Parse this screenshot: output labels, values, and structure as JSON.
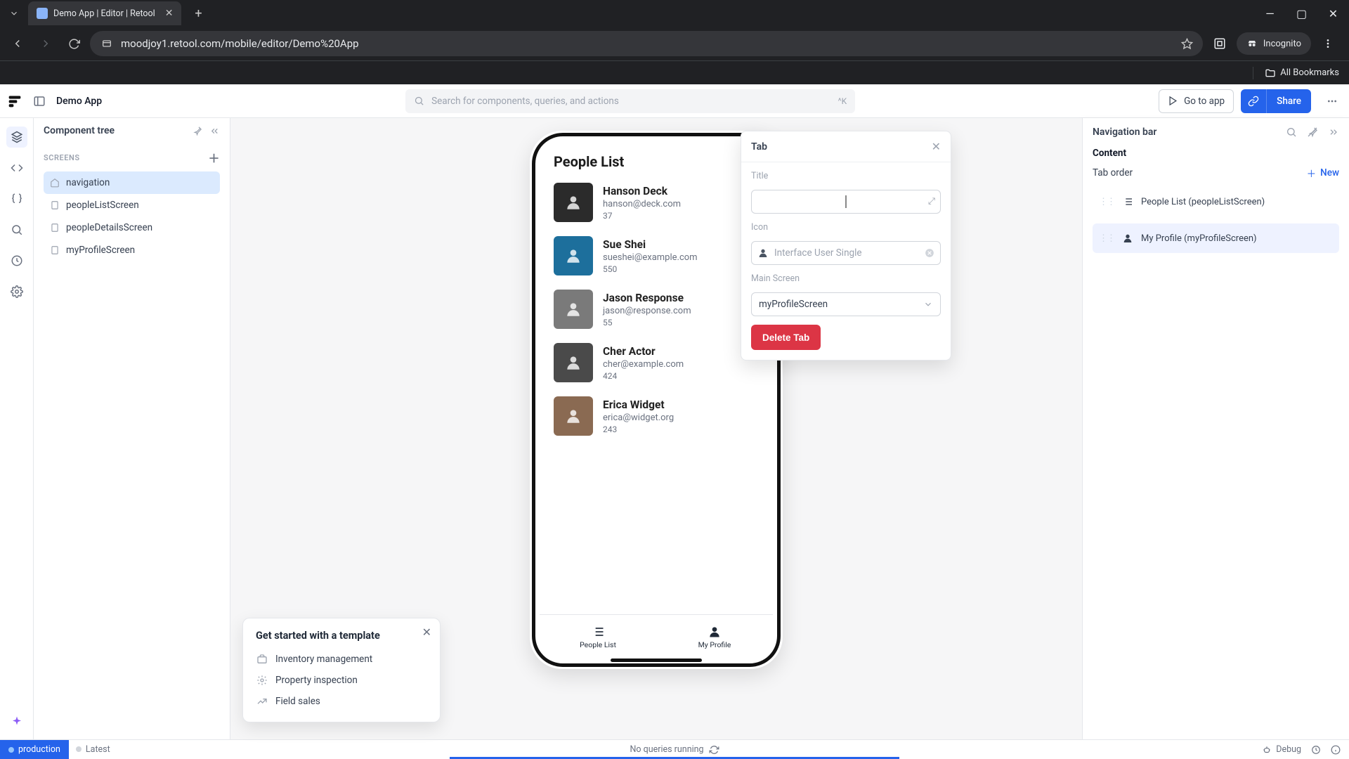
{
  "browser": {
    "tab_title": "Demo App | Editor | Retool",
    "url": "moodjoy1.retool.com/mobile/editor/Demo%20App",
    "incognito_label": "Incognito",
    "all_bookmarks": "All Bookmarks"
  },
  "header": {
    "app_name": "Demo App",
    "search_placeholder": "Search for components, queries, and actions",
    "search_kbd": "^K",
    "go_to_app": "Go to app",
    "share": "Share"
  },
  "tree": {
    "title": "Component tree",
    "section_screens": "SCREENS",
    "nodes": [
      {
        "label": "navigation",
        "selected": true
      },
      {
        "label": "peopleListScreen",
        "selected": false
      },
      {
        "label": "peopleDetailsScreen",
        "selected": false
      },
      {
        "label": "myProfileScreen",
        "selected": false
      }
    ]
  },
  "phone": {
    "title": "People List",
    "tabs": {
      "people": "People List",
      "profile": "My Profile"
    },
    "people": [
      {
        "name": "Hanson Deck",
        "email": "hanson@deck.com",
        "count": "37"
      },
      {
        "name": "Sue Shei",
        "email": "sueshei@example.com",
        "count": "550"
      },
      {
        "name": "Jason Response",
        "email": "jason@response.com",
        "count": "55"
      },
      {
        "name": "Cher Actor",
        "email": "cher@example.com",
        "count": "424"
      },
      {
        "name": "Erica Widget",
        "email": "erica@widget.org",
        "count": "243"
      }
    ]
  },
  "tab_popover": {
    "title": "Tab",
    "title_label": "Title",
    "title_value": "",
    "icon_label": "Icon",
    "icon_value": "Interface User Single",
    "mainscreen_label": "Main Screen",
    "mainscreen_value": "myProfileScreen",
    "delete_label": "Delete Tab"
  },
  "inspector": {
    "title": "Navigation bar",
    "content_label": "Content",
    "taborder_label": "Tab order",
    "new_label": "New",
    "items": [
      {
        "label": "People List (peopleListScreen)",
        "icon": "list",
        "selected": false
      },
      {
        "label": "My Profile (myProfileScreen)",
        "icon": "user",
        "selected": true
      }
    ]
  },
  "template_card": {
    "title": "Get started with a template",
    "items": [
      "Inventory management",
      "Property inspection",
      "Field sales"
    ]
  },
  "status": {
    "env": "production",
    "latest": "Latest",
    "center": "No queries running",
    "debug": "Debug"
  },
  "colors": {
    "primary": "#2563eb",
    "danger": "#dc3545"
  }
}
